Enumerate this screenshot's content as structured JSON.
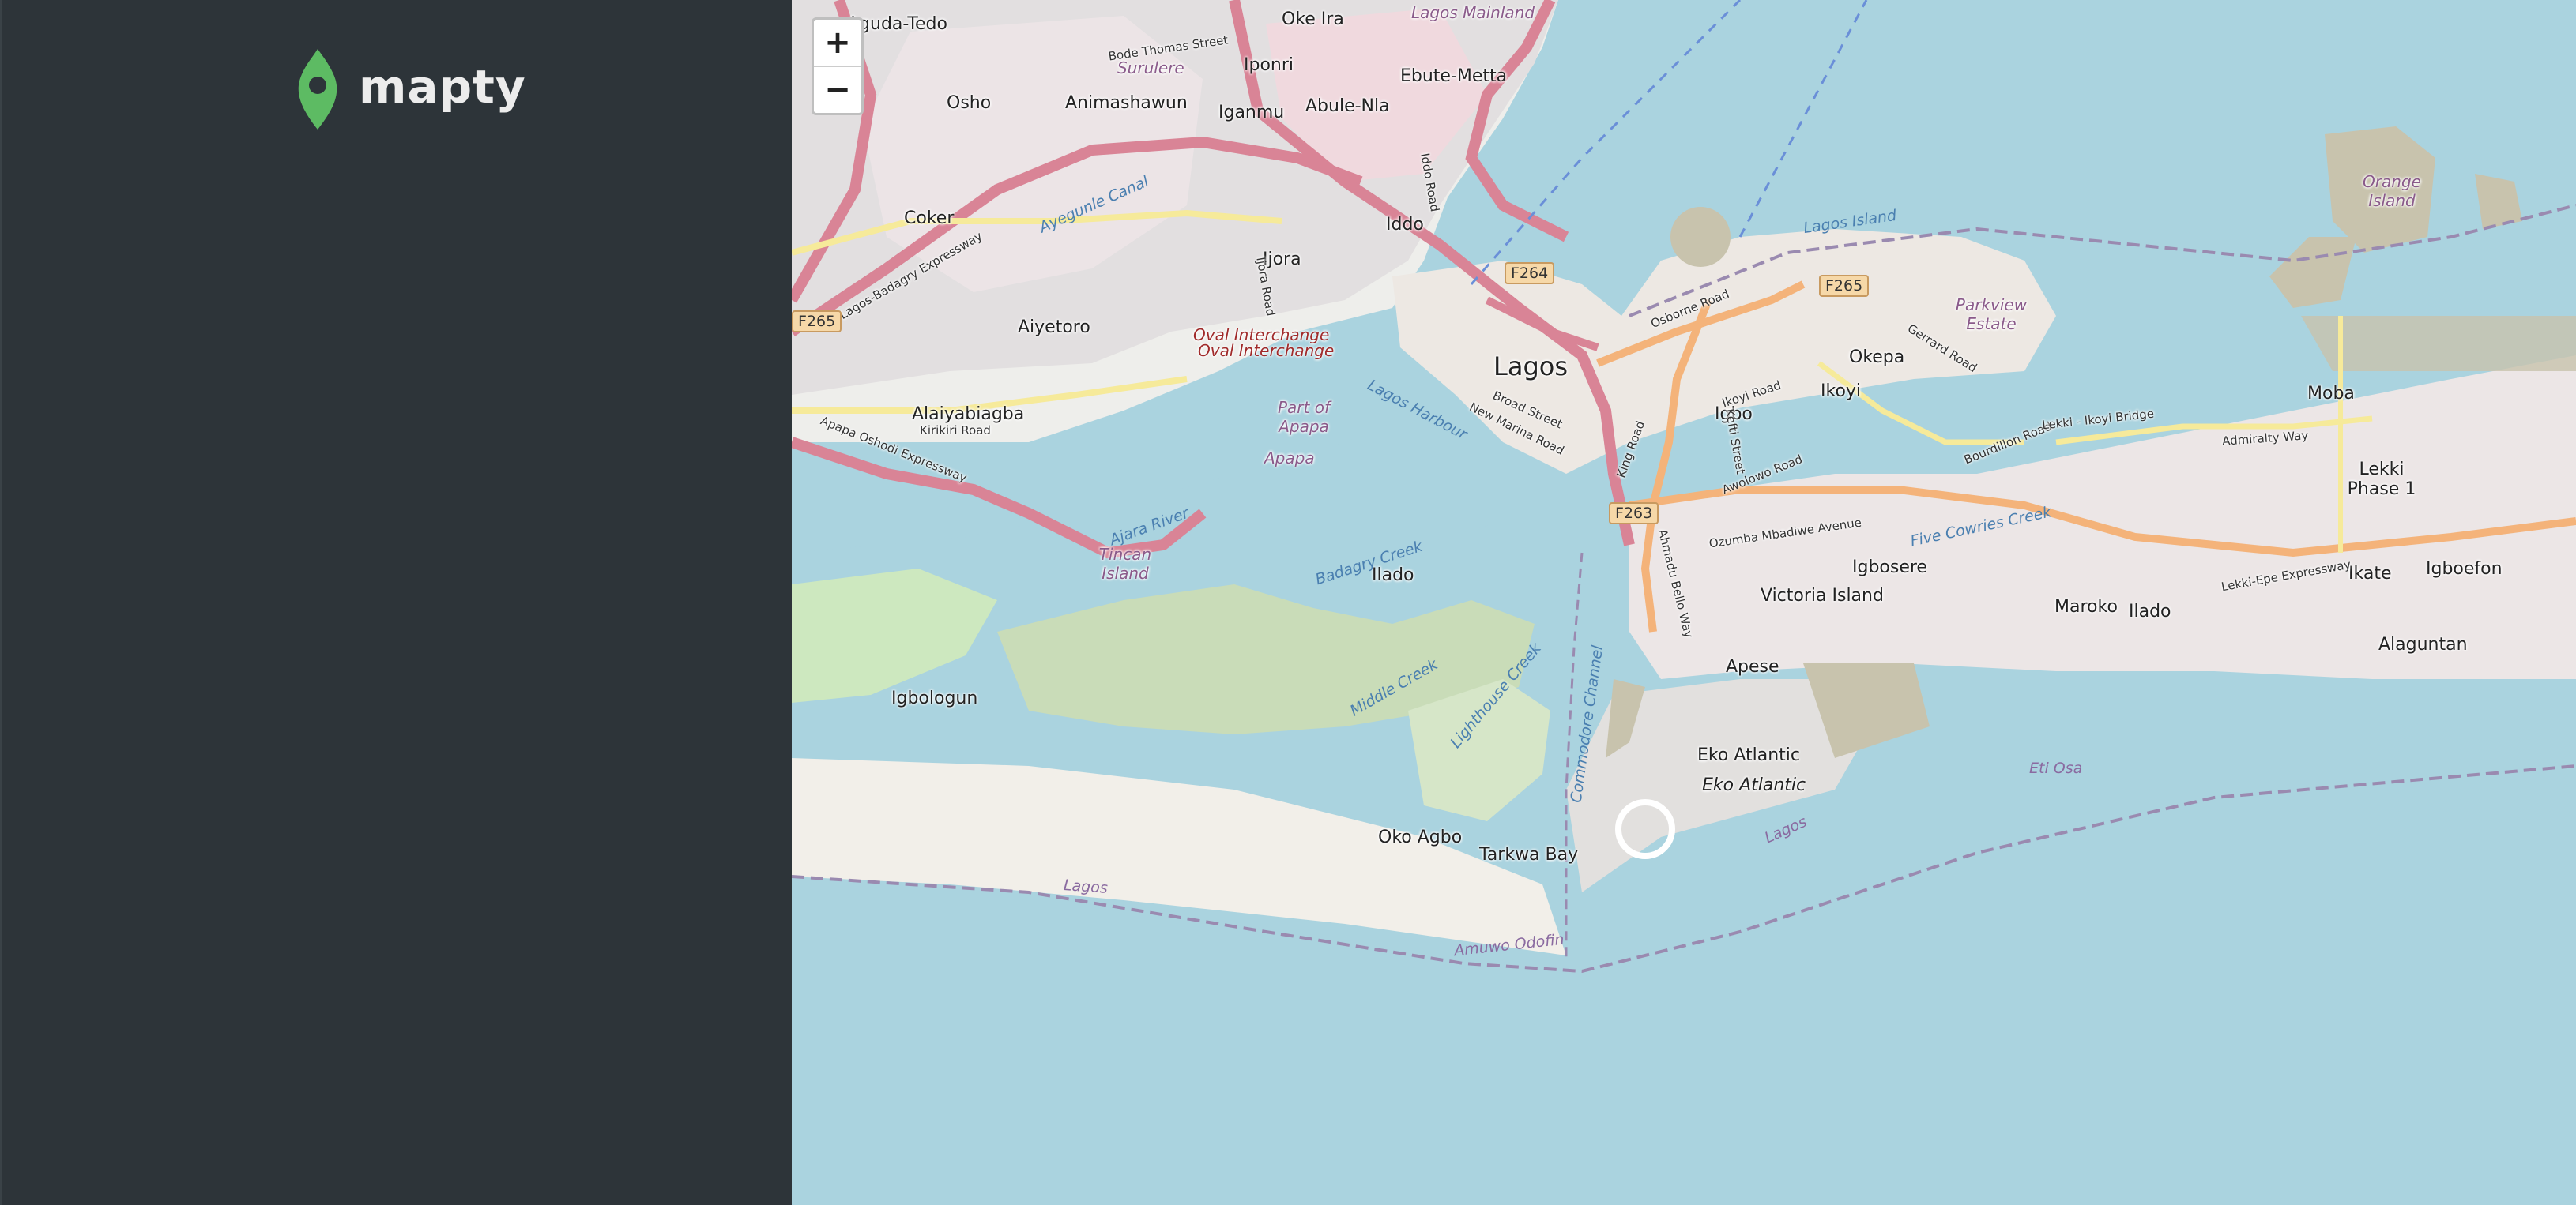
{
  "app": {
    "logo_text": "mapty",
    "brand_color": "#5dbb63",
    "sidebar_bg": "#2d3439"
  },
  "map": {
    "zoom_in_label": "+",
    "zoom_out_label": "−",
    "labels": [
      "Lagos",
      "Ikoyi",
      "Victoria Island",
      "Maroko",
      "Ilado",
      "Ikate",
      "Igboefon",
      "Alaguntan",
      "Lekki Phase 1",
      "Moba",
      "Okepa",
      "Parkview Estate",
      "Igbo",
      "Igbosere",
      "Apese",
      "Eko Atlantic",
      "Eko Atlantic",
      "Oko Agbo",
      "Tarkwa Bay",
      "Ilado",
      "Igbologun",
      "Tincan Island",
      "Apapa",
      "Part of Apapa",
      "Alaiyabiagba",
      "Aiyetoro",
      "Coker",
      "Ijora",
      "Iddo",
      "Iganmu",
      "Abule-Nla",
      "Ebute-Metta",
      "Oke Ira",
      "Iponri",
      "Surulere",
      "Animashawun",
      "Osho",
      "Aguda-Tedo",
      "Lagos Mainland",
      "Oval Interchange",
      "Oval Interchange",
      "Orange Island"
    ],
    "water_labels": [
      "Lagos Island",
      "Lagos Harbour",
      "Badagry Creek",
      "Five Cowries Creek",
      "Middle Creek",
      "Lighthouse Creek",
      "Commodore Channel",
      "Lagos",
      "Amuwo Odofin",
      "Eti Osa",
      "Lagos",
      "Ajara River",
      "Ayegunle Canal"
    ],
    "road_labels": [
      "Lagos-Badagry Expressway",
      "Apapa Oshodi Expressway",
      "Kirikiri Road",
      "Osborne Road",
      "Gerrard Road",
      "Bourdillon Road",
      "Awolowo Road",
      "Ikoyi Road",
      "Kefti Street",
      "Broad Street",
      "New Marina Road",
      "Ozumba Mbadiwe Avenue",
      "Lekki-Epe Expressway",
      "Admiralty Way",
      "Lekki - Ikoyi Bridge",
      "Ahmadu Bello Way",
      "Bode Thomas Street",
      "Ijora Road",
      "Iddo Road",
      "King Road"
    ],
    "shields": [
      "F264",
      "F265",
      "F263",
      "F265"
    ]
  }
}
